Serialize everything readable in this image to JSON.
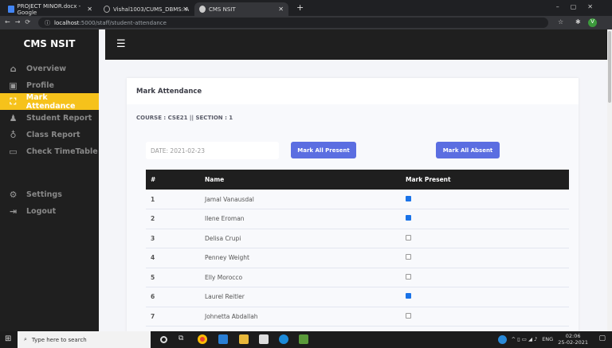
{
  "browser": {
    "tabs": [
      {
        "title": "PROJECT MINOR.docx - Google"
      },
      {
        "title": "Vishal1003/CUMS_DBMS: A"
      },
      {
        "title": "CMS NSIT",
        "active": true
      }
    ],
    "url_host": "localhost",
    "url_path": ":5000/staff/student-attendance",
    "new_tab": "+"
  },
  "sidebar": {
    "brand": "CMS NSIT",
    "items": [
      {
        "label": "Overview",
        "icon": "home-icon",
        "glyph": "⌂"
      },
      {
        "label": "Profile",
        "icon": "id-card-icon",
        "glyph": "▣"
      },
      {
        "label": "Mark Attendance",
        "icon": "chalkboard-teacher-icon",
        "glyph": "⛶",
        "active": true
      },
      {
        "label": "Student Report",
        "icon": "book-reader-icon",
        "glyph": "♟"
      },
      {
        "label": "Class Report",
        "icon": "award-icon",
        "glyph": "♁"
      },
      {
        "label": "Check TimeTable",
        "icon": "monitor-icon",
        "glyph": "▭"
      }
    ],
    "bottom": [
      {
        "label": "Settings",
        "icon": "gear-icon",
        "glyph": "⚙"
      },
      {
        "label": "Logout",
        "icon": "sign-out-icon",
        "glyph": "⇥"
      }
    ]
  },
  "topbar": {
    "menu_icon": "hamburger-icon"
  },
  "card": {
    "title": "Mark Attendance",
    "course_info": "COURSE : CSE21 || SECTION : 1",
    "date": "DATE: 2021-02-23",
    "mark_all_present": "Mark All Present",
    "mark_all_absent": "Mark All Absent",
    "columns": [
      "#",
      "Name",
      "Mark Present"
    ],
    "rows": [
      {
        "n": "1",
        "name": "Jamal Vanausdal",
        "present": true
      },
      {
        "n": "2",
        "name": "Ilene Eroman",
        "present": true
      },
      {
        "n": "3",
        "name": "Delisa Crupi",
        "present": false
      },
      {
        "n": "4",
        "name": "Penney Weight",
        "present": false
      },
      {
        "n": "5",
        "name": "Elly Morocco",
        "present": false
      },
      {
        "n": "6",
        "name": "Laurel Reitler",
        "present": true
      },
      {
        "n": "7",
        "name": "Johnetta Abdallah",
        "present": false
      }
    ]
  },
  "taskbar": {
    "search_placeholder": "Type here to search",
    "lang": "ENG",
    "time": "02:06",
    "date": "25-02-2021"
  },
  "colors": {
    "accent": "#f6c21b",
    "button": "#5b6ee1",
    "dark": "#1f1f1f"
  }
}
